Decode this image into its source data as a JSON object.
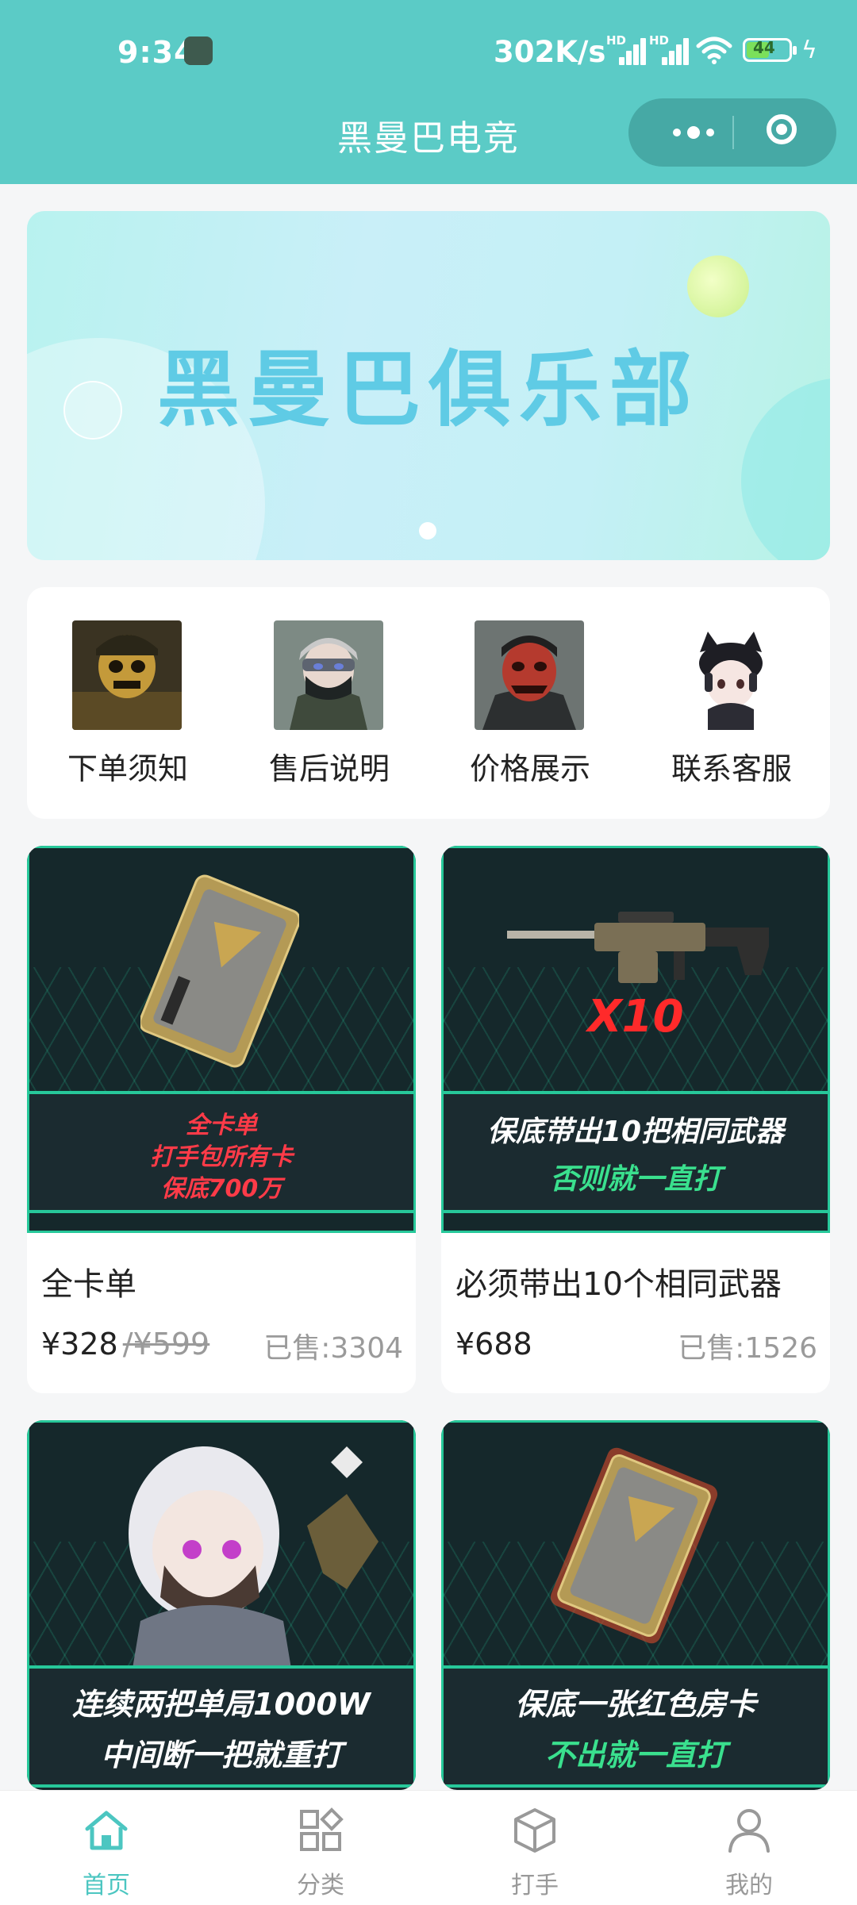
{
  "status_bar": {
    "time": "9:34",
    "network_speed": "302K/s",
    "battery": "44",
    "signal_tag": "HD"
  },
  "header": {
    "title": "黑曼巴电竞"
  },
  "banner": {
    "text": "黑曼巴俱乐部"
  },
  "quick_links": [
    {
      "label": "下单须知"
    },
    {
      "label": "售后说明"
    },
    {
      "label": "价格展示"
    },
    {
      "label": "联系客服"
    }
  ],
  "products": [
    {
      "name": "全卡单",
      "price": "¥328",
      "old_price": "/¥599",
      "sold": "已售:3304",
      "poster_lines": [
        "全卡单",
        "打手包所有卡",
        "保底700万"
      ],
      "badge": ""
    },
    {
      "name": "必须带出10个相同武器",
      "price": "¥688",
      "old_price": "",
      "sold": "已售:1526",
      "poster_lines": [
        "保底带出10把相同武器",
        "否则就一直打"
      ],
      "badge": "X10"
    },
    {
      "name": "",
      "price": "",
      "old_price": "",
      "sold": "",
      "poster_lines": [
        "连续两把单局1000W",
        "中间断一把就重打"
      ],
      "badge": ""
    },
    {
      "name": "",
      "price": "",
      "old_price": "",
      "sold": "",
      "poster_lines": [
        "保底一张红色房卡",
        "不出就一直打"
      ],
      "badge": ""
    }
  ],
  "tabbar": [
    {
      "label": "首页",
      "icon": "home-icon",
      "active": true
    },
    {
      "label": "分类",
      "icon": "category-icon",
      "active": false
    },
    {
      "label": "打手",
      "icon": "box-icon",
      "active": false
    },
    {
      "label": "我的",
      "icon": "user-icon",
      "active": false
    }
  ],
  "colors": {
    "primary": "#5bcbc6",
    "accent_green": "#27c89a",
    "poster_bg": "#15282b"
  }
}
